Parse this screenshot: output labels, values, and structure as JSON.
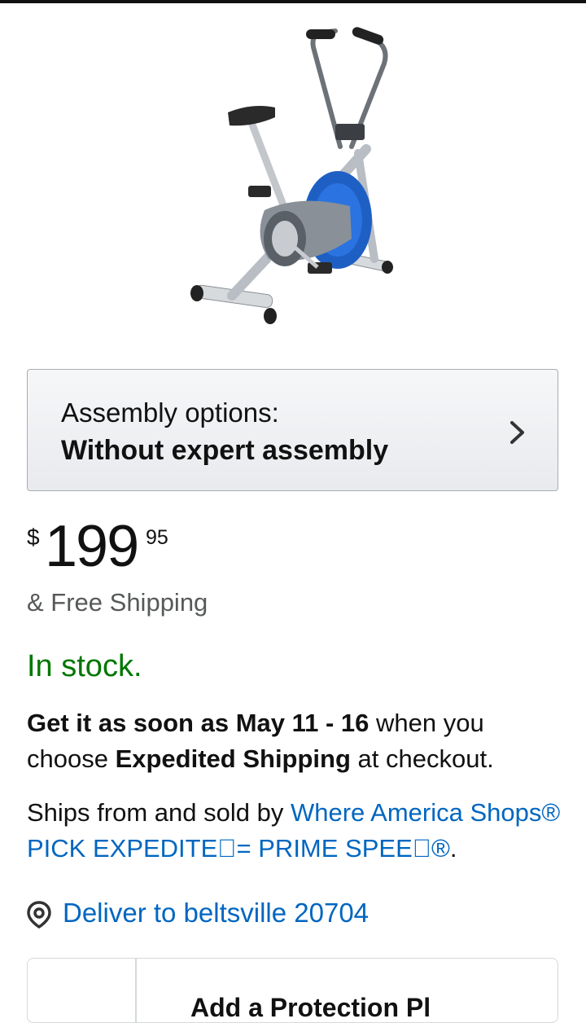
{
  "product": {
    "image_alt": "exercise-bike-image"
  },
  "assembly": {
    "label": "Assembly options:",
    "value": "Without expert assembly"
  },
  "price": {
    "currency": "$",
    "whole": "199",
    "fraction": "95"
  },
  "shipping": "& Free Shipping",
  "stock_status": "In stock.",
  "delivery": {
    "prefix": "Get it as soon as May 11 - 16",
    "middle": " when you choose ",
    "method": "Expedited Shipping",
    "suffix": " at checkout."
  },
  "seller": {
    "prefix": "Ships from and sold by ",
    "name": "Where America Shops® PICK EXPEDITE\u0000= PRIME SPEE\u0000®",
    "suffix": "."
  },
  "location": {
    "text": "Deliver to beltsville 20704"
  },
  "addon": {
    "title": "Add a Protection Pl"
  },
  "colors": {
    "link": "#0066c0",
    "in_stock": "#007600"
  }
}
